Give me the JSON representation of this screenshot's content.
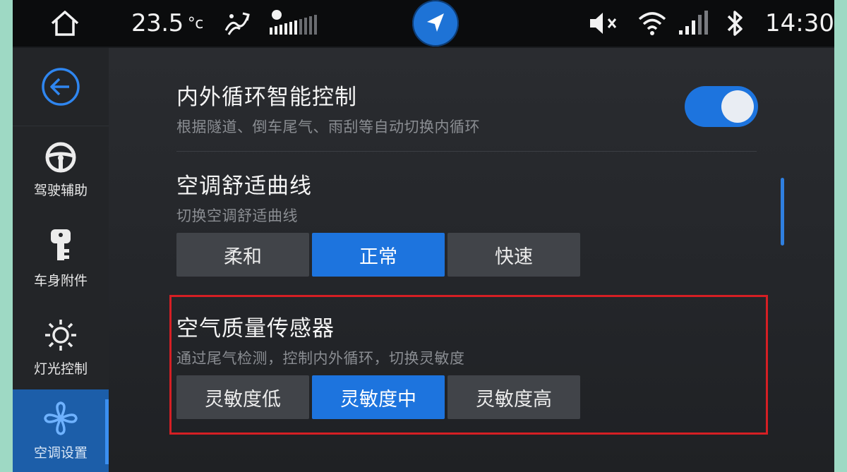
{
  "status_bar": {
    "temperature": "23.5",
    "temperature_unit": "°c",
    "time": "14:30",
    "icons": [
      "home-icon",
      "ac-airflow-icon",
      "fan-speed-icon",
      "navigation-icon",
      "mute-icon",
      "wifi-icon",
      "signal-icon",
      "bluetooth-icon"
    ]
  },
  "sidebar": {
    "items": [
      {
        "label": "驾驶辅助"
      },
      {
        "label": "车身附件"
      },
      {
        "label": "灯光控制"
      },
      {
        "label": "空调设置"
      }
    ],
    "active_index": 3
  },
  "settings": {
    "recirc": {
      "title": "内外循环智能控制",
      "description": "根据隧道、倒车尾气、雨刮等自动切换内循环",
      "enabled": true
    },
    "comfort": {
      "title": "空调舒适曲线",
      "description": "切换空调舒适曲线",
      "options": [
        "柔和",
        "正常",
        "快速"
      ],
      "selected": "正常"
    },
    "air_quality": {
      "title": "空气质量传感器",
      "description": "通过尾气检测，控制内外循环，切换灵敏度",
      "options": [
        "灵敏度低",
        "灵敏度中",
        "灵敏度高"
      ],
      "selected": "灵敏度中"
    }
  },
  "colors": {
    "accent": "#1d74de",
    "highlight_border": "#d51f24",
    "background": "#1a1c1f"
  }
}
